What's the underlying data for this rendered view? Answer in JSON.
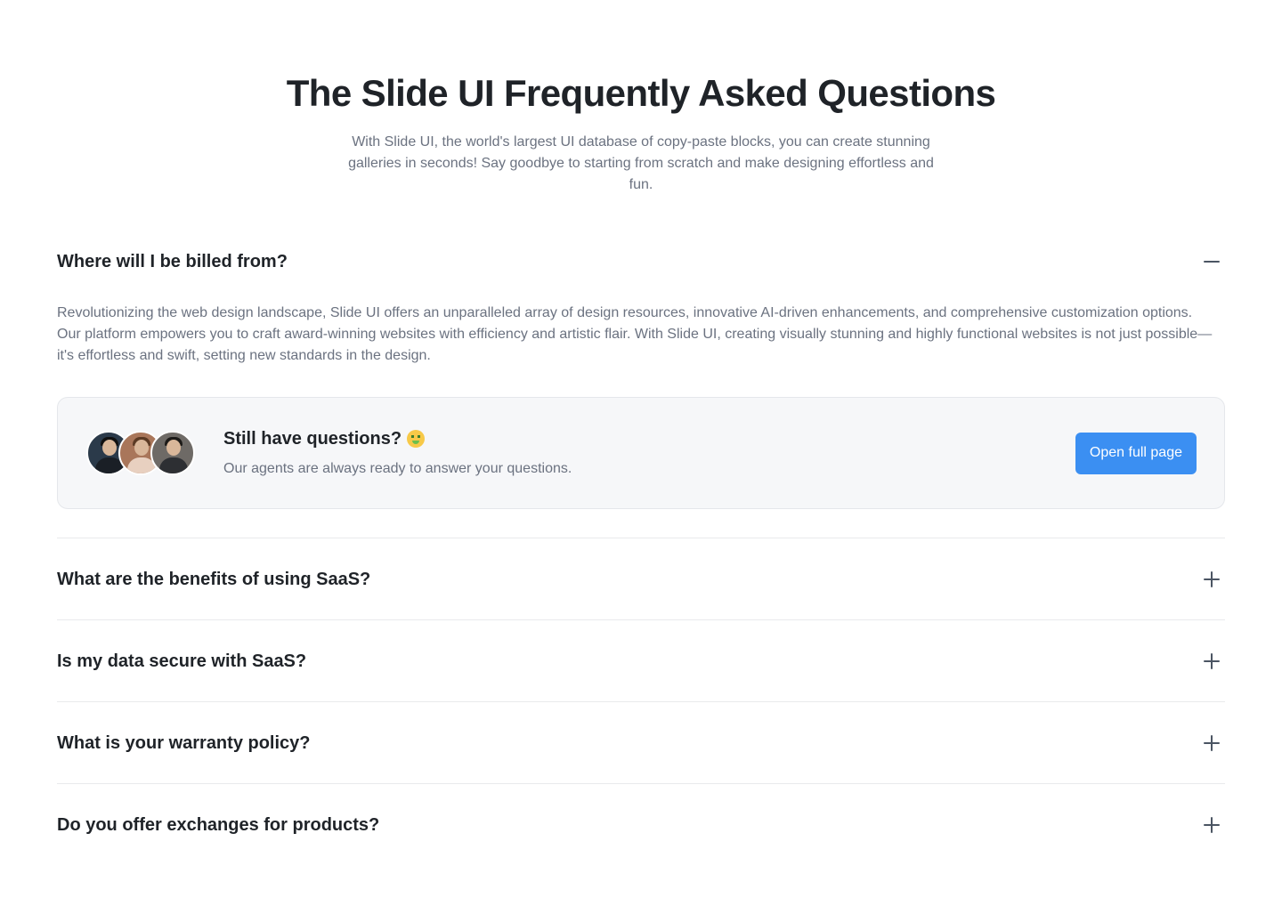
{
  "hero": {
    "title": "The Slide UI Frequently Asked Questions",
    "description": "With Slide UI, the world's largest UI database of copy-paste blocks, you can create stunning galleries in seconds! Say goodbye to starting from scratch and make designing effortless and fun."
  },
  "faq": {
    "open_item": {
      "question": "Where will I be billed from?",
      "answer": "Revolutionizing the web design landscape, Slide UI offers an unparalleled array of design resources, innovative AI-driven enhancements, and comprehensive customization options. Our platform empowers you to craft award-winning websites with efficiency and artistic flair. With Slide UI, creating visually stunning and highly functional websites is not just possible—it's effortless and swift, setting new standards in the design.",
      "toggle_icon": "minus-icon"
    },
    "contact": {
      "title": "Still have questions?",
      "emoji": "money-mouth-face-emoji",
      "subtitle": "Our agents are always ready to answer your questions.",
      "button_label": "Open full page",
      "button_color": "#3b8ff2",
      "avatars": [
        "agent-avatar-1",
        "agent-avatar-2",
        "agent-avatar-3"
      ]
    },
    "items": [
      {
        "question": "What are the benefits of using SaaS?",
        "toggle_icon": "plus-icon"
      },
      {
        "question": "Is my data secure with SaaS?",
        "toggle_icon": "plus-icon"
      },
      {
        "question": "What is your warranty policy?",
        "toggle_icon": "plus-icon"
      },
      {
        "question": "Do you offer exchanges for products?",
        "toggle_icon": "plus-icon"
      }
    ]
  }
}
